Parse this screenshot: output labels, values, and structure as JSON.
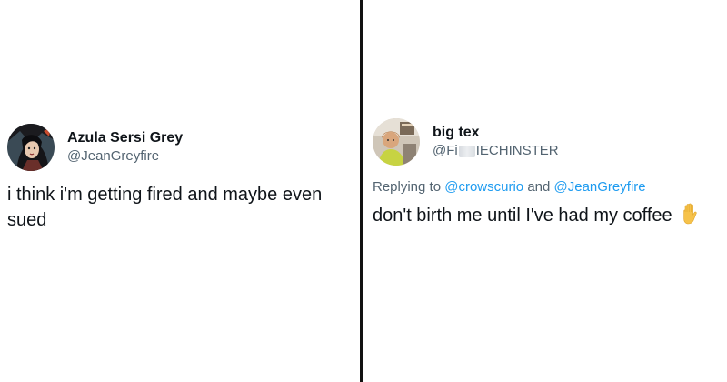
{
  "left_tweet": {
    "display_name": "Azula Sersi Grey",
    "handle": "@JeanGreyfire",
    "text": "i think i'm getting fired and maybe even sued",
    "avatar_icon": "comic-avatar-icon"
  },
  "right_tweet": {
    "display_name": "big tex",
    "handle_prefix": "@Fi",
    "handle_suffix": "IECHINSTER",
    "replying_to_label": "Replying to",
    "reply_mention_1": "@crowscurio",
    "reply_and": "and",
    "reply_mention_2": "@JeanGreyfire",
    "text": "don't birth me until I've had my coffee",
    "emoji": "raised-hand-emoji",
    "avatar_icon": "photo-avatar-icon"
  },
  "colors": {
    "text_primary": "#0f1419",
    "text_secondary": "#536471",
    "link": "#1d9bf0",
    "divider": "#111111"
  }
}
